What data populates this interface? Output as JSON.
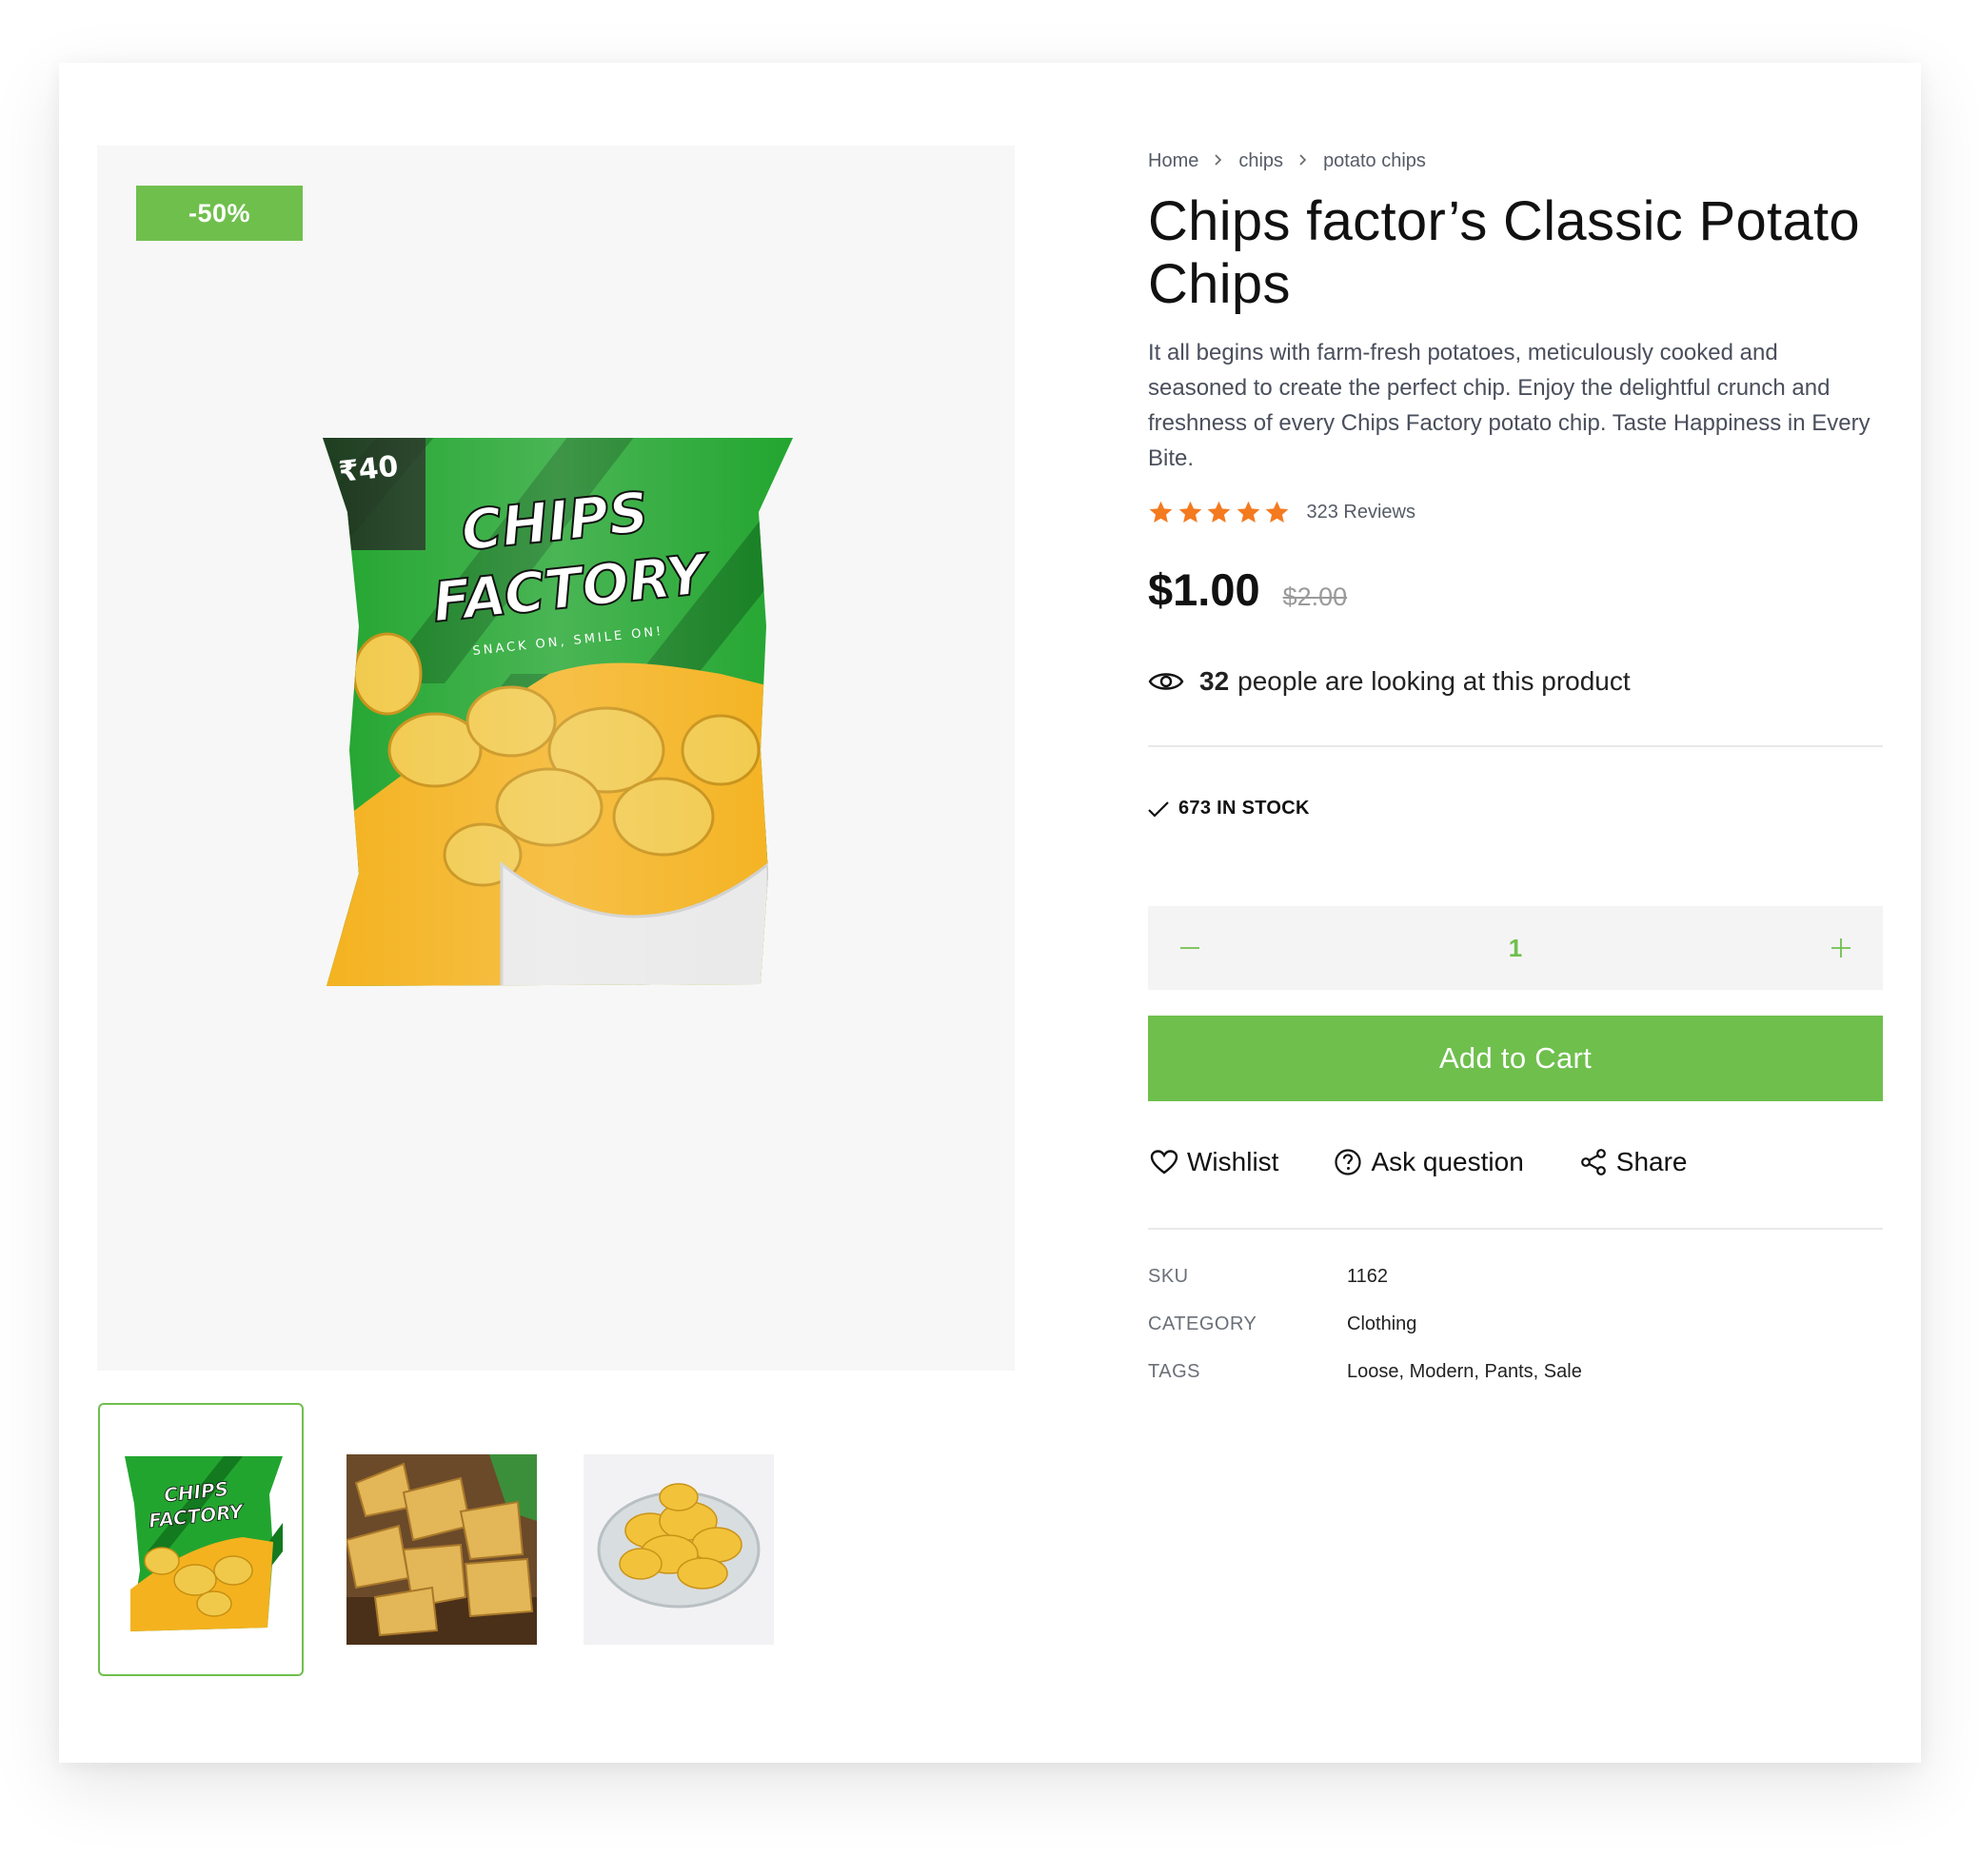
{
  "product": {
    "discount_badge": "-50%",
    "title": "Chips factor’s Classic Potato Chips",
    "description": "It all begins with farm-fresh potatoes, meticulously cooked and seasoned to create the perfect chip. Enjoy the delightful crunch and freshness of every Chips Factory potato chip. Taste Happiness in Every Bite.",
    "rating_stars": 5,
    "reviews": "323 Reviews",
    "price": "$1.00",
    "old_price": "$2.00",
    "viewers_count": "32",
    "viewers_text": "people are looking at this product",
    "stock": "673 IN STOCK",
    "quantity": "1",
    "add_to_cart": "Add to Cart"
  },
  "package": {
    "price_tag": "₹40",
    "brand_line1": "CHIPS",
    "brand_line2": "FACTORY",
    "tagline": "SNACK ON, SMILE ON!"
  },
  "breadcrumb": [
    "Home",
    "chips",
    "potato chips"
  ],
  "actions": {
    "wishlist": "Wishlist",
    "ask_question": "Ask question",
    "share": "Share"
  },
  "meta": {
    "sku_label": "SKU",
    "sku_value": "1162",
    "category_label": "CATEGORY",
    "category_value": "Clothing",
    "tags_label": "TAGS",
    "tags_value": "Loose, Modern, Pants, Sale"
  },
  "colors": {
    "accent_green": "#6fbf4d",
    "star_orange": "#f47a1f",
    "text_dark": "#111111",
    "text_muted": "#555b66"
  }
}
